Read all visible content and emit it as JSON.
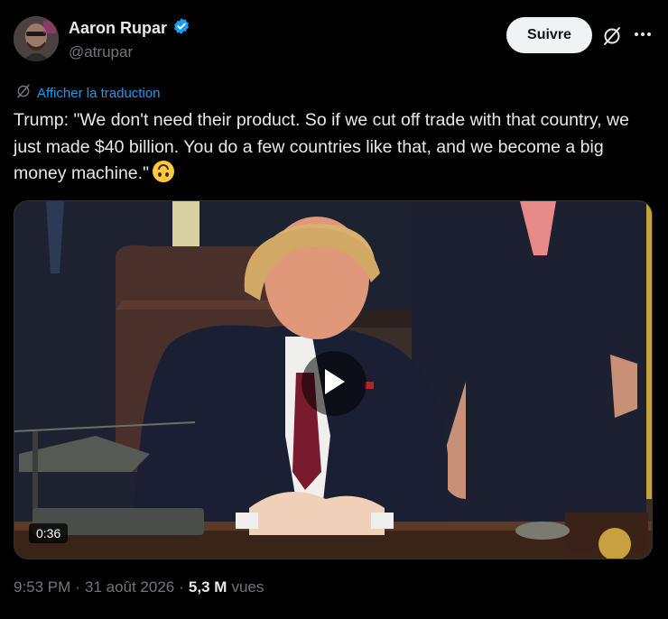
{
  "author": {
    "name": "Aaron Rupar",
    "handle": "@atrupar",
    "verified": true,
    "verified_color": "#1d9bf0"
  },
  "actions": {
    "follow_label": "Suivre",
    "grok_icon": "grok-icon",
    "more_icon": "more-icon"
  },
  "translate": {
    "label": "Afficher la traduction",
    "icon": "translate-icon"
  },
  "tweet": {
    "text": "Trump: \"We don't need their product. So if we cut off trade with that country, we just made $40 billion. You do a few countries like that, and we become a big money machine.\"",
    "emoji": "upside-down-face"
  },
  "video": {
    "duration": "0:36",
    "play_icon": "play-icon"
  },
  "meta": {
    "time": "9:53 PM",
    "date": "31 août 2026",
    "separator": "·",
    "views_count": "5,3 M",
    "views_label": "vues"
  },
  "colors": {
    "background": "#000000",
    "text": "#e7e9ea",
    "secondary": "#71767b",
    "link": "#1d9bf0"
  }
}
